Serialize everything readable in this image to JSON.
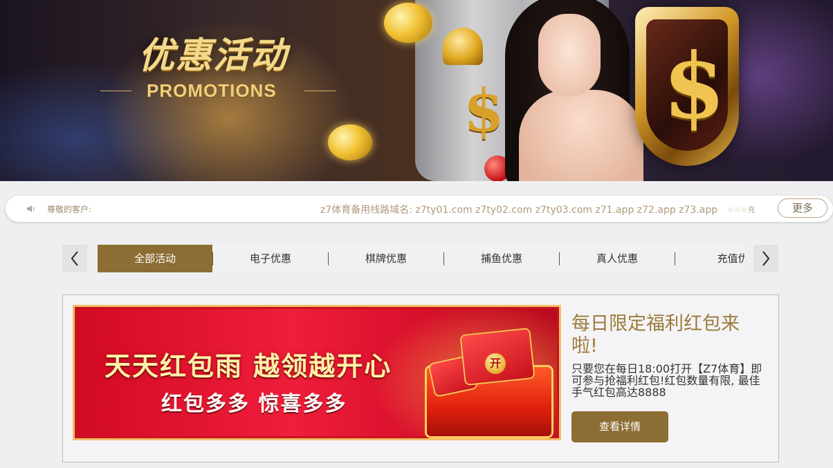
{
  "hero": {
    "title_cn": "优惠活动",
    "title_en": "PROMOTIONS"
  },
  "notice": {
    "icon": "speaker-icon",
    "label": "尊敬的客户:",
    "text": "z7体育备用线路域名: z7ty01.com z7ty02.com z7ty03.com z71.app z72.app z73.app",
    "tail": "☆☆☆充",
    "more_label": "更多"
  },
  "tabs": {
    "prev_icon": "chevron-left-icon",
    "next_icon": "chevron-right-icon",
    "items": [
      {
        "label": "全部活动",
        "active": true
      },
      {
        "label": "电子优惠",
        "active": false
      },
      {
        "label": "棋牌优惠",
        "active": false
      },
      {
        "label": "捕鱼优惠",
        "active": false
      },
      {
        "label": "真人优惠",
        "active": false
      },
      {
        "label": "充值优",
        "active": false
      }
    ]
  },
  "promo": {
    "banner_headline": "天天红包雨 越领越开心",
    "banner_sub": "红包多多 惊喜多多",
    "banner_badge": "开",
    "title": "每日限定福利红包来啦!",
    "description": "只要您在每日18:00打开【Z7体育】即可参与抢福利红包!红包数量有限, 最佳手气红包高达8888",
    "button_label": "查看详情"
  },
  "colors": {
    "accent_gold": "#8c6d33",
    "title_gold": "#9b7a3a",
    "notice_text": "#b09a7a"
  }
}
